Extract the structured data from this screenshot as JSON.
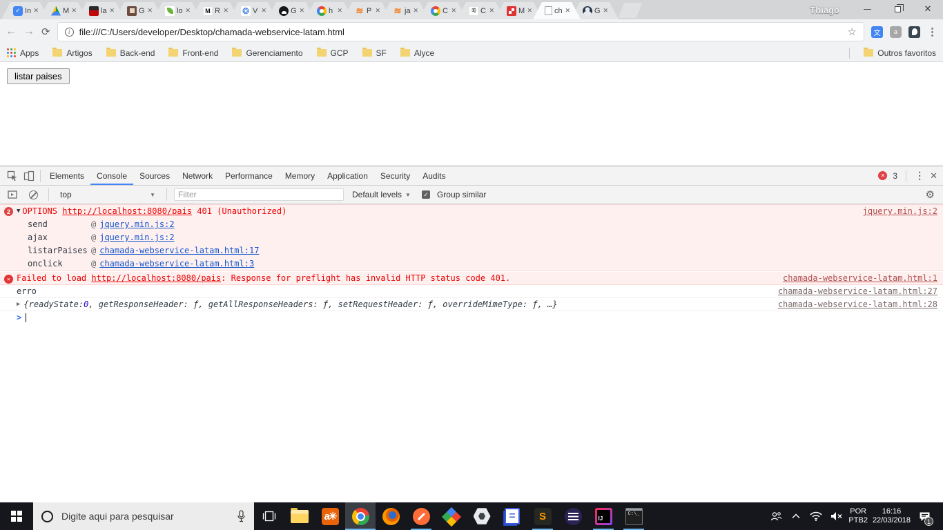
{
  "browser": {
    "profile": "Thiago",
    "tabs": [
      {
        "title": "In"
      },
      {
        "title": "M"
      },
      {
        "title": "la"
      },
      {
        "title": "G"
      },
      {
        "title": "lo"
      },
      {
        "title": "R"
      },
      {
        "title": "V"
      },
      {
        "title": "G"
      },
      {
        "title": "h"
      },
      {
        "title": "P"
      },
      {
        "title": "ja"
      },
      {
        "title": "C"
      },
      {
        "title": "C"
      },
      {
        "title": "M"
      },
      {
        "title": "ch"
      },
      {
        "title": "G"
      }
    ],
    "url": "file:///C:/Users/developer/Desktop/chamada-webservice-latam.html",
    "bookmarks": {
      "apps": "Apps",
      "folders": [
        "Artigos",
        "Back-end",
        "Front-end",
        "Gerenciamento",
        "GCP",
        "SF",
        "Alyce"
      ],
      "others": "Outros favoritos"
    }
  },
  "page": {
    "button_label": "listar paises"
  },
  "devtools": {
    "tabs": [
      "Elements",
      "Console",
      "Sources",
      "Network",
      "Performance",
      "Memory",
      "Application",
      "Security",
      "Audits"
    ],
    "active_tab": "Console",
    "error_count": "3",
    "toolbar": {
      "context": "top",
      "filter_placeholder": "Filter",
      "levels": "Default levels",
      "group_similar": "Group similar"
    },
    "console": {
      "group": {
        "badge": "2",
        "method": "OPTIONS",
        "url": "http://localhost:8080/pais",
        "status": "401 (Unauthorized)",
        "source": "jquery.min.js:2",
        "at": "@",
        "stack": [
          {
            "fn": "send",
            "src": "jquery.min.js:2"
          },
          {
            "fn": "ajax",
            "src": "jquery.min.js:2"
          },
          {
            "fn": "listarPaises",
            "src": "chamada-webservice-latam.html:17"
          },
          {
            "fn": "onclick",
            "src": "chamada-webservice-latam.html:3"
          }
        ]
      },
      "failed": {
        "pre": "Failed to load ",
        "url": "http://localhost:8080/pais",
        "post": ": Response for preflight has invalid HTTP status code 401.",
        "source": "chamada-webservice-latam.html:1"
      },
      "log_erro": {
        "text": "erro",
        "source": "chamada-webservice-latam.html:27"
      },
      "object_row": {
        "open": "{readyState: ",
        "num": "0",
        "rest": ", getResponseHeader: ƒ, getAllResponseHeaders: ƒ, setRequestHeader: ƒ, overrideMimeType: ƒ, …}",
        "source": "chamada-webservice-latam.html:28"
      },
      "prompt": ">"
    }
  },
  "taskbar": {
    "search_placeholder": "Digite aqui para pesquisar",
    "apps": [
      {
        "name": "file-explorer",
        "running": false
      },
      {
        "name": "a-orange-app",
        "running": false
      },
      {
        "name": "chrome",
        "running": true,
        "active": true
      },
      {
        "name": "firefox",
        "running": false
      },
      {
        "name": "postman",
        "running": true
      },
      {
        "name": "drive-diamond",
        "running": false
      },
      {
        "name": "google-cloud",
        "running": false
      },
      {
        "name": "notes-app",
        "running": false
      },
      {
        "name": "sublime-text",
        "running": true
      },
      {
        "name": "eclipse",
        "running": false
      },
      {
        "name": "intellij-idea",
        "running": true
      },
      {
        "name": "command-prompt",
        "running": true
      }
    ],
    "tray": {
      "lang_top": "POR",
      "lang_bottom": "PTB2",
      "time": "16:16",
      "date": "22/03/2018",
      "notification_badge": "1"
    }
  },
  "colors": {
    "accent_blue": "#4285f4",
    "error_red": "#eb0000",
    "error_bg": "#fff0f0",
    "link_blue": "#1155cc",
    "taskbar_underline": "#6cb8f0"
  }
}
